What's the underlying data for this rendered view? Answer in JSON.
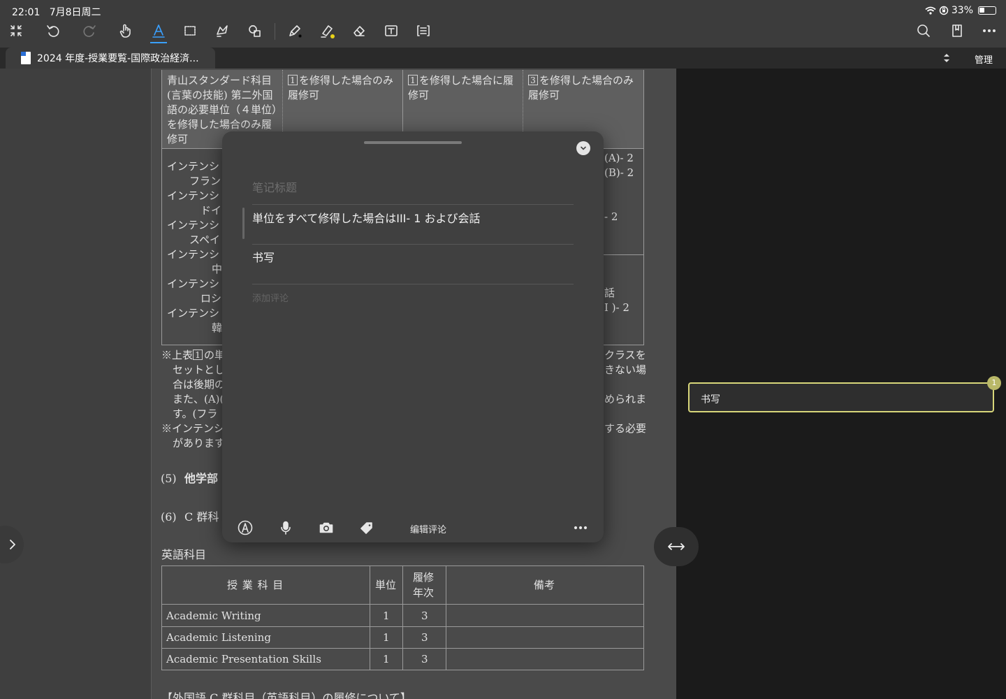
{
  "status_bar": {
    "time": "22:01",
    "date": "7月8日周二",
    "battery": "33%",
    "battery_level": 0.33
  },
  "toolbar": {
    "icons": [
      "collapse-icon",
      "undo-icon",
      "redo-icon",
      "hand-icon",
      "text-select-icon",
      "crop-icon",
      "lasso-icon",
      "shapes-icon",
      "pen-icon",
      "highlighter-icon",
      "eraser-icon",
      "textbox-icon",
      "outline-icon",
      "search-icon",
      "bookmark-icon",
      "more-icon"
    ],
    "active": "text-select-icon",
    "accent": "#3aa0ff"
  },
  "tab": {
    "title": "2024 年度-授業要覧-国際政治経済...",
    "manage_label": "管理"
  },
  "document": {
    "table1": {
      "header": {
        "col1": [
          "青山スタンダード科目",
          "(言葉の技能) 第二外国",
          "語の必要単位（４単位）",
          "を修得した場合のみ履",
          "修可"
        ],
        "col2_num": "1",
        "col2": [
          "を修得した場合のみ",
          "履修可"
        ],
        "col3_num": "1",
        "col3": [
          "を修得した場合に履",
          "修可"
        ],
        "col4_num": "3",
        "col4": [
          "を修得した場合のみ",
          "履修可"
        ]
      },
      "left_rows": [
        "インテンシ",
        "フラン",
        "インテンシ",
        "ドイ",
        "インテンシ",
        "スペイ",
        "インテンシ",
        "中",
        "インテンシ",
        "ロシ",
        "インテンシ",
        "韓"
      ],
      "right_rows": [
        "(A)- 2",
        "(B)- 2",
        "- 2",
        "話",
        "I )- 2"
      ]
    },
    "notes_left": [
      "※上表",
      "の単",
      "セットとし",
      "合は後期の",
      "また、(A)(",
      "す。(フラ",
      "※インテンシ",
      "があります"
    ],
    "notes_left_num": "1",
    "notes_right": [
      "クラスを",
      "きない場",
      "められま",
      "する必要"
    ],
    "section5": {
      "num": "(5)",
      "title": "他学部"
    },
    "section6": {
      "num": "(6)",
      "title": "C 群科"
    },
    "english_heading": "英語科目",
    "table2": {
      "headers": {
        "subject": "授 業 科 目",
        "units": "単位",
        "year": [
          "履修",
          "年次"
        ],
        "remarks": "備考"
      },
      "rows": [
        {
          "subject": "Academic Writing",
          "units": "1",
          "year": "3",
          "remarks": ""
        },
        {
          "subject": "Academic Listening",
          "units": "1",
          "year": "3",
          "remarks": ""
        },
        {
          "subject": "Academic Presentation Skills",
          "units": "1",
          "year": "3",
          "remarks": ""
        }
      ]
    },
    "bottom_cut": "【外国語 C 群科目（英語科目）の履修について】"
  },
  "note_popover": {
    "title_placeholder": "笔记标题",
    "quote": "単位をすべて修得した場合はIII- 1 および会話",
    "body": "书写",
    "comment_placeholder": "添加评论",
    "edit_comment_label": "编辑评论",
    "footer_icons": [
      "pen-circle-icon",
      "microphone-icon",
      "camera-icon",
      "tag-icon",
      "more-icon"
    ]
  },
  "side_panel": {
    "highlight_text": "书写",
    "highlight_count": "1",
    "highlight_color": "#d8d77a"
  }
}
